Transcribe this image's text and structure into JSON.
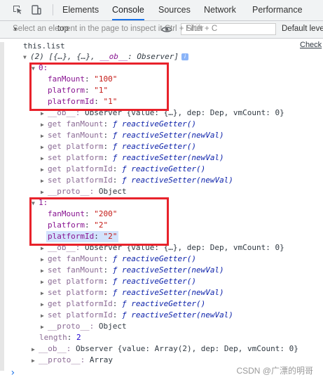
{
  "devtools": {
    "tabs": [
      "Elements",
      "Console",
      "Sources",
      "Network",
      "Performance"
    ],
    "active_tab": "Console",
    "accent": "#1a73e8"
  },
  "toolbar": {
    "tooltip": "Select an element in the page to inspect it  Ctrl + Shift + C",
    "context": "top",
    "filter_placeholder": "Filter",
    "levels": "Default leve"
  },
  "console": {
    "expression": "this.list",
    "check_link": "Check",
    "summary_prefix": "(2) [{…}, {…}, ",
    "summary_ob": "__ob__",
    "summary_suffix": ": Observer]",
    "items": [
      {
        "index": "0:",
        "fields": [
          {
            "key": "fanMount",
            "value": "\"100\""
          },
          {
            "key": "platform",
            "value": "\"1\""
          },
          {
            "key": "platformId",
            "value": "\"1\""
          }
        ]
      },
      {
        "index": "1:",
        "fields": [
          {
            "key": "fanMount",
            "value": "\"200\""
          },
          {
            "key": "platform",
            "value": "\"2\""
          },
          {
            "key": "platformId",
            "value": "\"2\""
          }
        ]
      }
    ],
    "ob_label": "__ob__",
    "ob_value": "Observer {value: {…}, dep: Dep, vmCount: 0}",
    "accessors": [
      {
        "kind": "get",
        "name": "fanMount",
        "fn": "reactiveGetter()"
      },
      {
        "kind": "set",
        "name": "fanMount",
        "fn": "reactiveSetter(newVal)"
      },
      {
        "kind": "get",
        "name": "platform",
        "fn": "reactiveGetter()"
      },
      {
        "kind": "set",
        "name": "platform",
        "fn": "reactiveSetter(newVal)"
      },
      {
        "kind": "get",
        "name": "platformId",
        "fn": "reactiveGetter()"
      },
      {
        "kind": "set",
        "name": "platformId",
        "fn": "reactiveSetter(newVal)"
      }
    ],
    "f_glyph": "ƒ",
    "proto_label": "__proto__",
    "proto_object": "Object",
    "length_label": "length",
    "length_value": "2",
    "outer_ob_value": "Observer {value: Array(2), dep: Dep, vmCount: 0}",
    "outer_proto_value": "Array"
  },
  "watermark": "CSDN @广漂的明哥",
  "highlight_color": "#e8222b"
}
